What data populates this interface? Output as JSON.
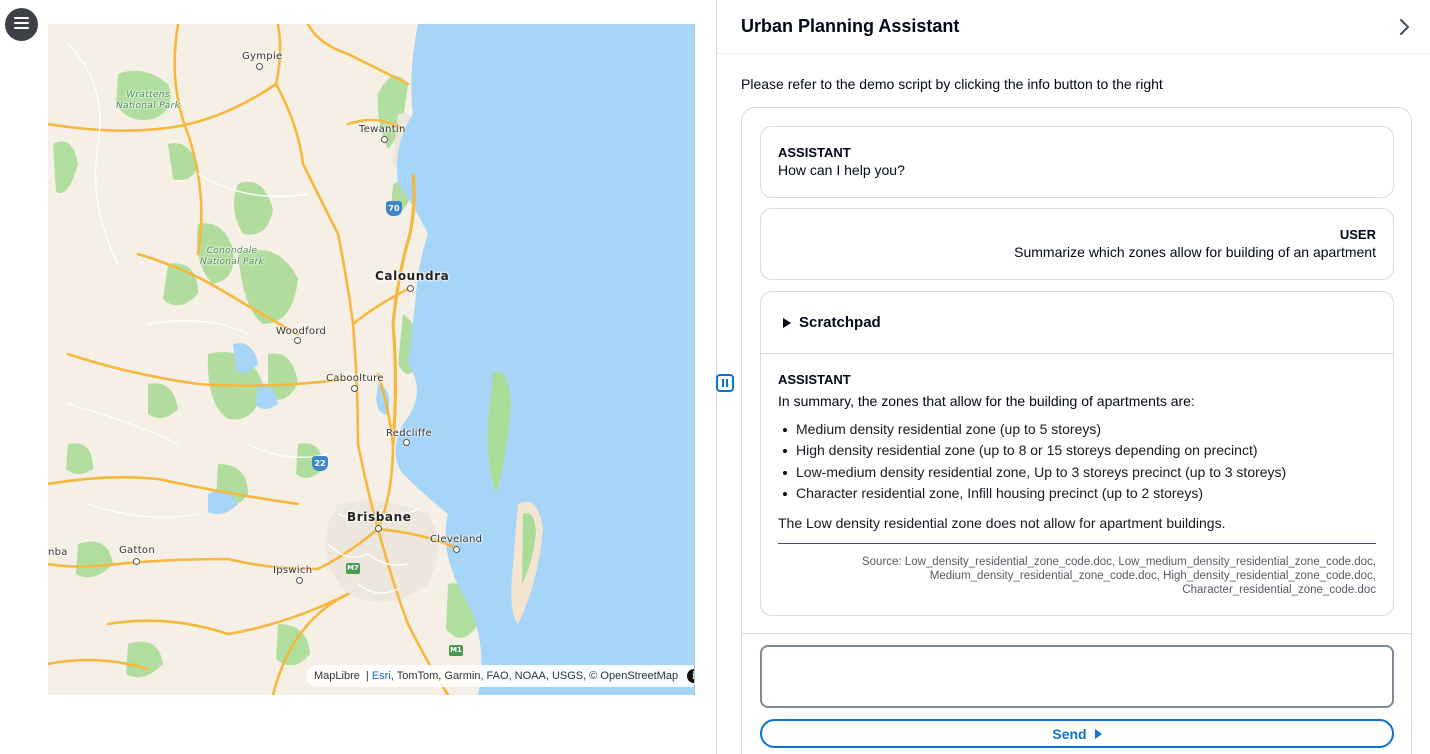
{
  "menu": {
    "icon": "hamburger-menu-icon"
  },
  "map": {
    "labels": {
      "gympie": "Gympie",
      "wrattens": "Wrattens\nNational Park",
      "tewantin": "Tewantin",
      "route70": "70",
      "conondale": "Conondale\nNational Park",
      "caloundra": "Caloundra",
      "woodford": "Woodford",
      "caboolture": "Caboolture",
      "redcliffe": "Redcliffe",
      "route22": "22",
      "brisbane": "Brisbane",
      "cleveland": "Cleveland",
      "gatton": "Gatton",
      "toowoomba_partial": "nba",
      "ipswich": "Ipswich",
      "m7": "M7",
      "m1": "M1"
    },
    "attribution": {
      "maplibre": "MapLibre",
      "separator": " | ",
      "esri": "Esri",
      "rest": ", TomTom, Garmin, FAO, NOAA, USGS, © OpenStreetMap",
      "info_icon": "info-icon"
    },
    "colors": {
      "water": "#a6d5f7",
      "land": "#f6efe5",
      "park": "#a9dc96",
      "road_major": "#f5b83d",
      "road_minor": "#ffffff"
    }
  },
  "panel": {
    "title": "Urban Planning Assistant",
    "collapse_icon": "chevron-right-icon",
    "intro": "Please refer to the demo script by clicking the info button to the right",
    "messages": [
      {
        "role": "ASSISTANT",
        "text": "How can I help you?"
      },
      {
        "role": "USER",
        "text": "Summarize which zones allow for building of an apartment"
      }
    ],
    "scratchpad": {
      "label": "Scratchpad"
    },
    "answer": {
      "role": "ASSISTANT",
      "intro": "In summary, the zones that allow for the building of apartments are:",
      "items": [
        "Medium density residential zone (up to 5 storeys)",
        "High density residential zone (up to 8 or 15 storeys depending on precinct)",
        "Low-medium density residential zone, Up to 3 storeys precinct (up to 3 storeys)",
        "Character residential zone, Infill housing precinct (up to 2 storeys)"
      ],
      "conclusion": "The Low density residential zone does not allow for apartment buildings.",
      "source_line1": "Source: Low_density_residential_zone_code.doc, Low_medium_density_residential_zone_code.doc,",
      "source_line2": "Medium_density_residential_zone_code.doc, High_density_residential_zone_code.doc,",
      "source_line3": "Character_residential_zone_code.doc"
    },
    "prompt": {
      "value": "",
      "placeholder": ""
    },
    "send_label": "Send",
    "accent": "#0972d3"
  }
}
